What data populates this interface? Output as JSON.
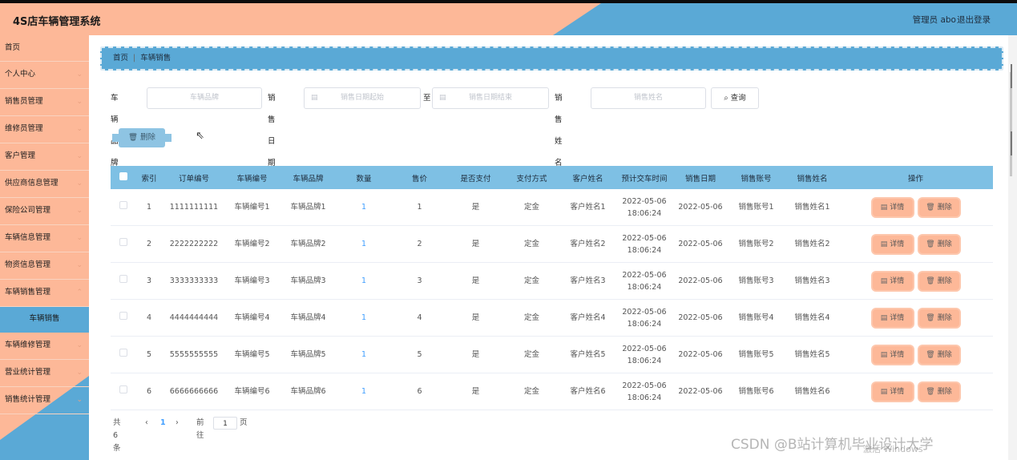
{
  "app": {
    "title": "4S店车辆管理系统",
    "admin_label": "管理员 abo",
    "logout_label": "退出登录"
  },
  "sidebar": {
    "items": [
      {
        "label": "首页"
      },
      {
        "label": "个人中心"
      },
      {
        "label": "销售员管理"
      },
      {
        "label": "维修员管理"
      },
      {
        "label": "客户管理"
      },
      {
        "label": "供应商信息管理"
      },
      {
        "label": "保险公司管理"
      },
      {
        "label": "车辆信息管理"
      },
      {
        "label": "物资信息管理"
      },
      {
        "label": "车辆销售管理"
      },
      {
        "label": "车辆销售"
      },
      {
        "label": "车辆维修管理"
      },
      {
        "label": "营业统计管理"
      },
      {
        "label": "销售统计管理"
      }
    ]
  },
  "breadcrumb": {
    "home": "首页",
    "separator": "|",
    "current": "车辆销售"
  },
  "search": {
    "brand_label": "车辆品牌",
    "brand_placeholder": "车辆品牌",
    "date_label": "销售日期",
    "date_start_placeholder": "销售日期起始",
    "to_label": "至",
    "date_end_placeholder": "销售日期结束",
    "name_label": "销售姓名",
    "name_placeholder": "销售姓名",
    "query_label": "查询"
  },
  "toolbar": {
    "delete_label": "删除"
  },
  "table": {
    "headers": [
      "索引",
      "订单编号",
      "车辆编号",
      "车辆品牌",
      "数量",
      "售价",
      "是否支付",
      "支付方式",
      "客户姓名",
      "预计交车时间",
      "销售日期",
      "销售账号",
      "销售姓名",
      "操作"
    ],
    "rows": [
      {
        "index": "1",
        "order_no": "1111111111",
        "vehicle_no": "车辆编号1",
        "brand": "车辆品牌1",
        "qty": "1",
        "price": "1",
        "paid": "是",
        "pay_method": "定金",
        "customer": "客户姓名1",
        "delivery_date": "2022-05-06",
        "delivery_time": "18:06:24",
        "sale_date": "2022-05-06",
        "sales_account": "销售账号1",
        "sales_name": "销售姓名1"
      },
      {
        "index": "2",
        "order_no": "2222222222",
        "vehicle_no": "车辆编号2",
        "brand": "车辆品牌2",
        "qty": "1",
        "price": "2",
        "paid": "是",
        "pay_method": "定金",
        "customer": "客户姓名2",
        "delivery_date": "2022-05-06",
        "delivery_time": "18:06:24",
        "sale_date": "2022-05-06",
        "sales_account": "销售账号2",
        "sales_name": "销售姓名2"
      },
      {
        "index": "3",
        "order_no": "3333333333",
        "vehicle_no": "车辆编号3",
        "brand": "车辆品牌3",
        "qty": "1",
        "price": "3",
        "paid": "是",
        "pay_method": "定金",
        "customer": "客户姓名3",
        "delivery_date": "2022-05-06",
        "delivery_time": "18:06:24",
        "sale_date": "2022-05-06",
        "sales_account": "销售账号3",
        "sales_name": "销售姓名3"
      },
      {
        "index": "4",
        "order_no": "4444444444",
        "vehicle_no": "车辆编号4",
        "brand": "车辆品牌4",
        "qty": "1",
        "price": "4",
        "paid": "是",
        "pay_method": "定金",
        "customer": "客户姓名4",
        "delivery_date": "2022-05-06",
        "delivery_time": "18:06:24",
        "sale_date": "2022-05-06",
        "sales_account": "销售账号4",
        "sales_name": "销售姓名4"
      },
      {
        "index": "5",
        "order_no": "5555555555",
        "vehicle_no": "车辆编号5",
        "brand": "车辆品牌5",
        "qty": "1",
        "price": "5",
        "paid": "是",
        "pay_method": "定金",
        "customer": "客户姓名5",
        "delivery_date": "2022-05-06",
        "delivery_time": "18:06:24",
        "sale_date": "2022-05-06",
        "sales_account": "销售账号5",
        "sales_name": "销售姓名5"
      },
      {
        "index": "6",
        "order_no": "6666666666",
        "vehicle_no": "车辆编号6",
        "brand": "车辆品牌6",
        "qty": "1",
        "price": "6",
        "paid": "是",
        "pay_method": "定金",
        "customer": "客户姓名6",
        "delivery_date": "2022-05-06",
        "delivery_time": "18:06:24",
        "sale_date": "2022-05-06",
        "sales_account": "销售账号6",
        "sales_name": "销售姓名6"
      }
    ],
    "detail_label": "详情",
    "delete_label": "删除"
  },
  "pagination": {
    "total_text": "共 6 条",
    "prev": "‹",
    "current_page": "1",
    "next": "›",
    "goto_label": "前往",
    "goto_value": "1",
    "page_suffix": "页"
  },
  "watermark": {
    "csdn": "CSDN @B站计算机毕业设计大学",
    "windows": "激活 Windows"
  },
  "colors": {
    "peach": "#fdb898",
    "blue": "#5aa9d6",
    "link": "#409eff"
  }
}
